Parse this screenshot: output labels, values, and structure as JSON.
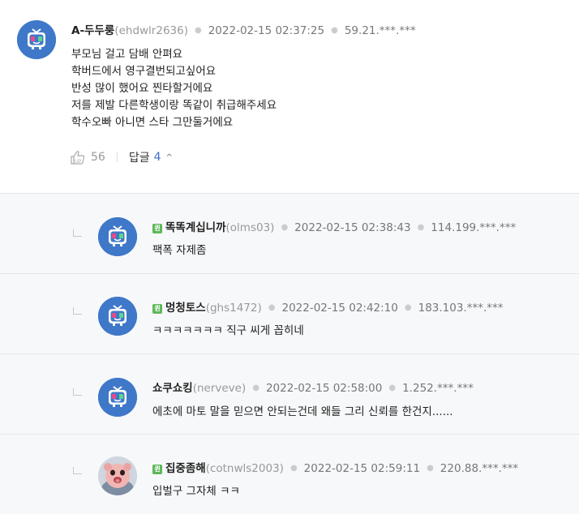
{
  "main": {
    "nickname": "A-두두룽",
    "user_id": "(ehdwlr2636)",
    "timestamp": "2022-02-15 02:37:25",
    "ip": "59.21.***.***",
    "lines": [
      "부모님 걸고 담배 안펴요",
      "학버드에서 영구결번되고싶어요",
      "반성 많이 했어요 찐타할거에요",
      "저를 제발 다른학생이랑 똑같이 취급해주세요",
      "학수오빠 아니면 스타 그만둘거에요"
    ],
    "like_count": "56",
    "reply_label": "답글",
    "reply_count": "4",
    "like_icon": "thumbs-up-icon",
    "chevron_icon": "chevron-up-icon"
  },
  "replies": [
    {
      "badge": "퀸",
      "nickname": "똑똑계십니까",
      "user_id": "(olms03)",
      "timestamp": "2022-02-15 02:38:43",
      "ip": "114.199.***.***",
      "text": "팩폭 자제좀"
    },
    {
      "badge": "퀸",
      "nickname": "멍청토스",
      "user_id": "(ghs1472)",
      "timestamp": "2022-02-15 02:42:10",
      "ip": "183.103.***.***",
      "text": "ㅋㅋㅋㅋㅋㅋㅋ 직구 씨게 꼽히네"
    },
    {
      "badge": "",
      "nickname": "쇼쿠쇼킹",
      "user_id": "(nerveve)",
      "timestamp": "2022-02-15 02:58:00",
      "ip": "1.252.***.***",
      "text": "에초에 마토 말을 믿으면 안되는건데 왜들 그리 신뢰를 한건지......"
    },
    {
      "badge": "퀸",
      "nickname": "집중좀해",
      "user_id": "(cotnwls2003)",
      "timestamp": "2022-02-15 02:59:11",
      "ip": "220.88.***.***",
      "text": "입벌구 그자체 ㅋㅋ"
    }
  ],
  "colors": {
    "avatar_bg": "#3f78c9",
    "reply_count": "#3d6fd0",
    "badge": "#5db85a"
  }
}
